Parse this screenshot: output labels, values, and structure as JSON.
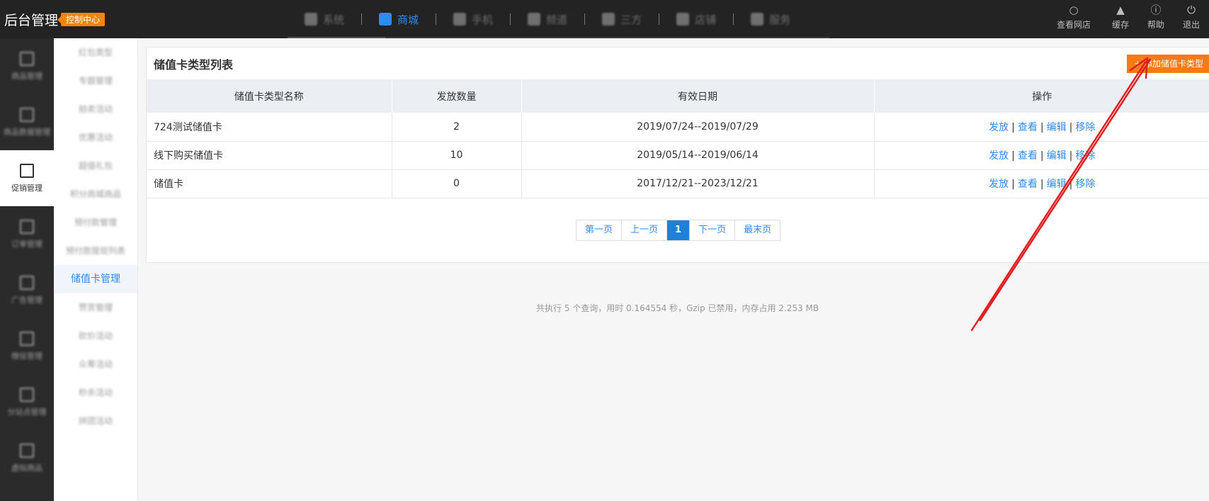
{
  "brand": {
    "title": "后台管理",
    "badge": "控制中心"
  },
  "topnav": {
    "items": [
      {
        "label": "系统",
        "active": false
      },
      {
        "label": "商城",
        "active": true
      },
      {
        "label": "手机",
        "active": false
      },
      {
        "label": "频道",
        "active": false
      },
      {
        "label": "三方",
        "active": false
      },
      {
        "label": "店铺",
        "active": false
      },
      {
        "label": "服务",
        "active": false
      }
    ]
  },
  "topright": [
    {
      "label": "查看网店",
      "icon": "search-icon"
    },
    {
      "label": "缓存",
      "icon": "broom-icon"
    },
    {
      "label": "帮助",
      "icon": "help-icon"
    },
    {
      "label": "退出",
      "icon": "power-icon"
    }
  ],
  "sidebar": {
    "items": [
      {
        "label": "商品管理",
        "active": false
      },
      {
        "label": "商品数据管理",
        "active": false
      },
      {
        "label": "促销管理",
        "active": true
      },
      {
        "label": "订单管理",
        "active": false
      },
      {
        "label": "广告管理",
        "active": false
      },
      {
        "label": "微信管理",
        "active": false
      },
      {
        "label": "分站点管理",
        "active": false
      },
      {
        "label": "虚拟商品",
        "active": false
      }
    ]
  },
  "submenu": {
    "items": [
      {
        "label": "红包类型",
        "active": false
      },
      {
        "label": "专题管理",
        "active": false
      },
      {
        "label": "拍卖活动",
        "active": false
      },
      {
        "label": "优惠活动",
        "active": false
      },
      {
        "label": "超值礼包",
        "active": false
      },
      {
        "label": "积分商城商品",
        "active": false
      },
      {
        "label": "预付款管理",
        "active": false
      },
      {
        "label": "预付款提现列表",
        "active": false
      },
      {
        "label": "储值卡管理",
        "active": true
      },
      {
        "label": "赞赏管理",
        "active": false
      },
      {
        "label": "砍价活动",
        "active": false
      },
      {
        "label": "众筹活动",
        "active": false
      },
      {
        "label": "秒杀活动",
        "active": false
      },
      {
        "label": "拼团活动",
        "active": false
      }
    ]
  },
  "main": {
    "title": "储值卡类型列表",
    "add_button": "+ 添加储值卡类型",
    "columns": [
      "储值卡类型名称",
      "发放数量",
      "有效日期",
      "操作"
    ],
    "rows": [
      {
        "name": "724测试储值卡",
        "count": "2",
        "date": "2019/07/24--2019/07/29"
      },
      {
        "name": "线下购买储值卡",
        "count": "10",
        "date": "2019/05/14--2019/06/14"
      },
      {
        "name": "储值卡",
        "count": "0",
        "date": "2017/12/21--2023/12/21"
      }
    ],
    "actions": {
      "issue": "发放",
      "view": "查看",
      "edit": "编辑",
      "remove": "移除",
      "sep": "|"
    },
    "pager": {
      "first": "第一页",
      "prev": "上一页",
      "current": "1",
      "next": "下一页",
      "last": "最末页"
    }
  },
  "footer": "共执行 5 个查询，用时 0.164554 秒，Gzip 已禁用，内存占用 2.253 MB",
  "colors": {
    "accent": "#2d8cf0",
    "add_button": "#f57c13",
    "annotation": "#e02020"
  }
}
